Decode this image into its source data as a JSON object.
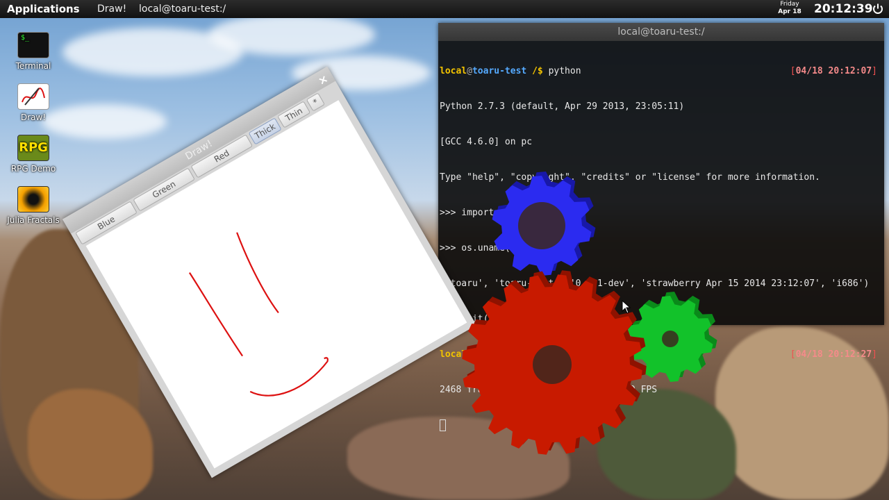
{
  "panel": {
    "applications": "Applications",
    "tasks": [
      "Draw!",
      "local@toaru-test:/"
    ],
    "day": "Friday",
    "date": "Apr 18",
    "time": "20:12:39",
    "power_icon": "power-icon"
  },
  "desktop_icons": [
    {
      "label": "Terminal",
      "icon": "terminal-icon"
    },
    {
      "label": "Draw!",
      "icon": "draw-icon"
    },
    {
      "label": "RPG Demo",
      "icon": "rpg-icon",
      "badge": "RPG"
    },
    {
      "label": "Julia Fractals",
      "icon": "fractal-icon"
    }
  ],
  "terminal": {
    "title": "local@toaru-test:/",
    "user": "local",
    "host": "toaru-test",
    "path": "/$",
    "cmd1": "python",
    "ts1": "04/18 20:12:07",
    "out1": "Python 2.7.3 (default, Apr 29 2013, 23:05:11)",
    "out2": "[GCC 4.6.0] on pc",
    "out3": "Type \"help\", \"copyright\", \"credits\" or \"license\" for more information.",
    "out4": ">>> import os",
    "out5": ">>> os.uname()",
    "out6": "('toaru', 'toaru-test', '0.6.1-dev', 'strawberry Apr 15 2014 23:12:07', 'i686')",
    "out7": ">>> quit()",
    "cmd2": "gears",
    "ts2": "04/18 20:12:27",
    "out8": "2468 frames in 5.0 seconds = 493.600 FPS"
  },
  "draw_window": {
    "title": "Draw!",
    "close": "×",
    "buttons": [
      "Blue",
      "Green",
      "Red",
      "Thick",
      "Thin",
      "*"
    ],
    "selected": "Thick",
    "stroke_color": "#dd1111"
  },
  "colors": {
    "gear_blue": "#2b2bf0",
    "gear_red": "#c81a00",
    "gear_green": "#12c22a"
  }
}
